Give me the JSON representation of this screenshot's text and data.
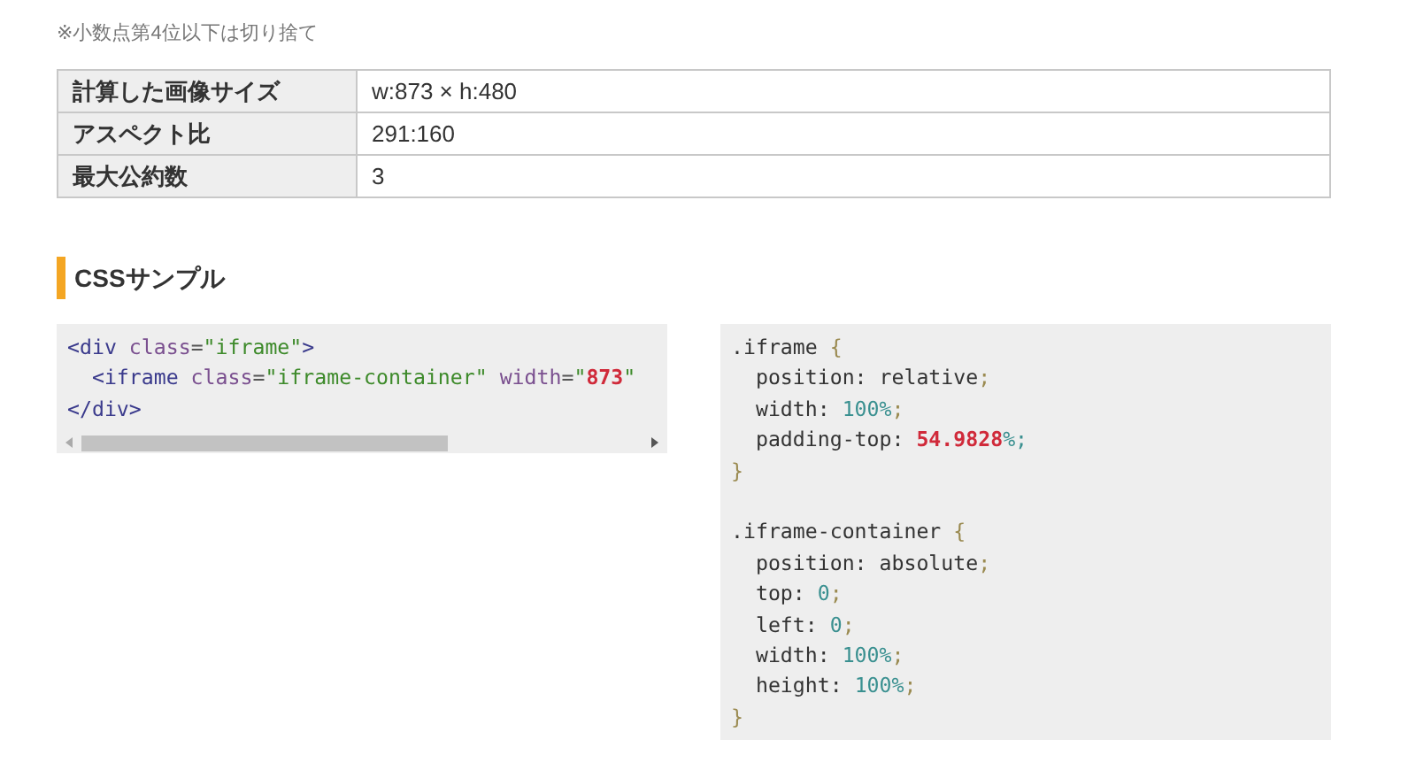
{
  "note": "※小数点第4位以下は切り捨て",
  "result_table": {
    "rows": [
      {
        "label": "計算した画像サイズ",
        "value": "w:873 × h:480"
      },
      {
        "label": "アスペクト比",
        "value": "291:160"
      },
      {
        "label": "最大公約数",
        "value": "3"
      }
    ]
  },
  "section_heading": "CSSサンプル",
  "code_samples": [
    {
      "horizontal_scrollbar": true,
      "blocks": [
        [
          [
            {
              "t": "<div",
              "kind": "tag"
            },
            {
              "t": " class",
              "kind": "attr"
            },
            {
              "t": "=",
              "kind": "punct"
            },
            {
              "t": "\"iframe\"",
              "kind": "str"
            },
            {
              "t": ">",
              "kind": "tag"
            }
          ],
          [
            {
              "t": "  <iframe",
              "kind": "tag"
            },
            {
              "t": " class",
              "kind": "attr"
            },
            {
              "t": "=",
              "kind": "punct"
            },
            {
              "t": "\"iframe-container\"",
              "kind": "str"
            },
            {
              "t": " width",
              "kind": "attr"
            },
            {
              "t": "=",
              "kind": "punct"
            },
            {
              "t": "\"",
              "kind": "str"
            },
            {
              "t": "873",
              "kind": "hl"
            },
            {
              "t": "\"",
              "kind": "str"
            }
          ],
          [
            {
              "t": "</div>",
              "kind": "tag"
            }
          ]
        ]
      ]
    },
    {
      "horizontal_scrollbar": false,
      "blocks": [
        [
          [
            {
              "t": ".iframe ",
              "kind": "sel"
            },
            {
              "t": "{",
              "kind": "brace"
            }
          ],
          [
            {
              "t": "  position: relative",
              "kind": "prop"
            },
            {
              "t": ";",
              "kind": "brace"
            }
          ],
          [
            {
              "t": "  width: ",
              "kind": "prop"
            },
            {
              "t": "100%",
              "kind": "num"
            },
            {
              "t": ";",
              "kind": "brace"
            }
          ],
          [
            {
              "t": "  padding-top: ",
              "kind": "prop"
            },
            {
              "t": "54.9828",
              "kind": "hl"
            },
            {
              "t": "%;",
              "kind": "num"
            }
          ],
          [
            {
              "t": "}",
              "kind": "brace"
            }
          ]
        ],
        [
          [
            {
              "t": ".iframe-container ",
              "kind": "sel"
            },
            {
              "t": "{",
              "kind": "brace"
            }
          ],
          [
            {
              "t": "  position: absolute",
              "kind": "prop"
            },
            {
              "t": ";",
              "kind": "brace"
            }
          ],
          [
            {
              "t": "  top: ",
              "kind": "prop"
            },
            {
              "t": "0",
              "kind": "num"
            },
            {
              "t": ";",
              "kind": "brace"
            }
          ],
          [
            {
              "t": "  left: ",
              "kind": "prop"
            },
            {
              "t": "0",
              "kind": "num"
            },
            {
              "t": ";",
              "kind": "brace"
            }
          ],
          [
            {
              "t": "  width: ",
              "kind": "prop"
            },
            {
              "t": "100%",
              "kind": "num"
            },
            {
              "t": ";",
              "kind": "brace"
            }
          ],
          [
            {
              "t": "  height: ",
              "kind": "prop"
            },
            {
              "t": "100%",
              "kind": "num"
            },
            {
              "t": ";",
              "kind": "brace"
            }
          ],
          [
            {
              "t": "}",
              "kind": "brace"
            }
          ]
        ]
      ]
    }
  ]
}
